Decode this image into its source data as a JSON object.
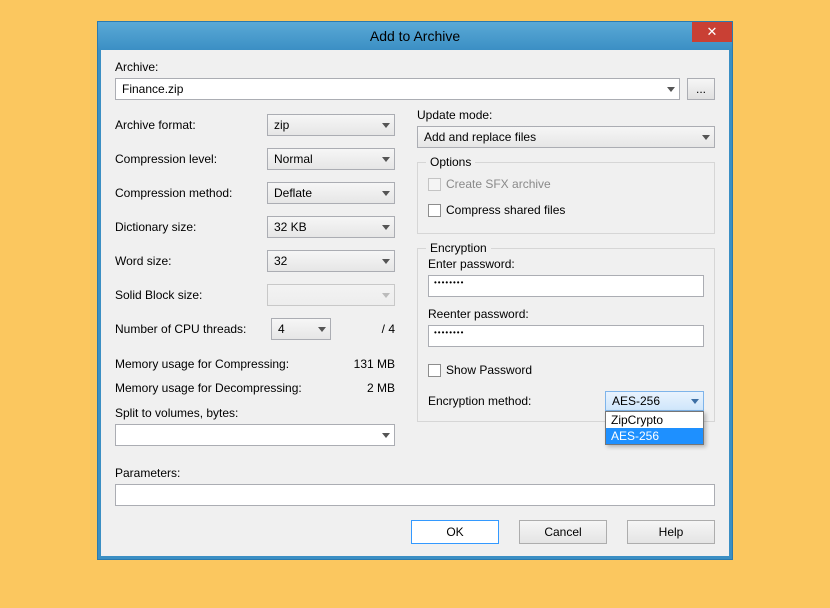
{
  "title": "Add to Archive",
  "close_icon": "✕",
  "archive_label": "Archive:",
  "archive_value": "Finance.zip",
  "browse_dots": "...",
  "left": {
    "format_label": "Archive format:",
    "format_value": "zip",
    "level_label": "Compression level:",
    "level_value": "Normal",
    "method_label": "Compression method:",
    "method_value": "Deflate",
    "dict_label": "Dictionary size:",
    "dict_value": "32 KB",
    "word_label": "Word size:",
    "word_value": "32",
    "solid_label": "Solid Block size:",
    "solid_value": "",
    "threads_label": "Number of CPU threads:",
    "threads_value": "4",
    "threads_total": "/ 4",
    "mem_comp_label": "Memory usage for Compressing:",
    "mem_comp_value": "131 MB",
    "mem_decomp_label": "Memory usage for Decompressing:",
    "mem_decomp_value": "2 MB",
    "split_label": "Split to volumes, bytes:",
    "split_value": ""
  },
  "right": {
    "update_label": "Update mode:",
    "update_value": "Add and replace files",
    "options_legend": "Options",
    "sfx_label": "Create SFX archive",
    "shared_label": "Compress shared files",
    "enc_legend": "Encryption",
    "enter_pw_label": "Enter password:",
    "reenter_pw_label": "Reenter password:",
    "pw_mask": "••••••••",
    "show_pw_label": "Show Password",
    "enc_method_label": "Encryption method:",
    "enc_method_value": "AES-256",
    "enc_options": [
      "ZipCrypto",
      "AES-256"
    ]
  },
  "params_label": "Parameters:",
  "params_value": "",
  "buttons": {
    "ok": "OK",
    "cancel": "Cancel",
    "help": "Help"
  }
}
